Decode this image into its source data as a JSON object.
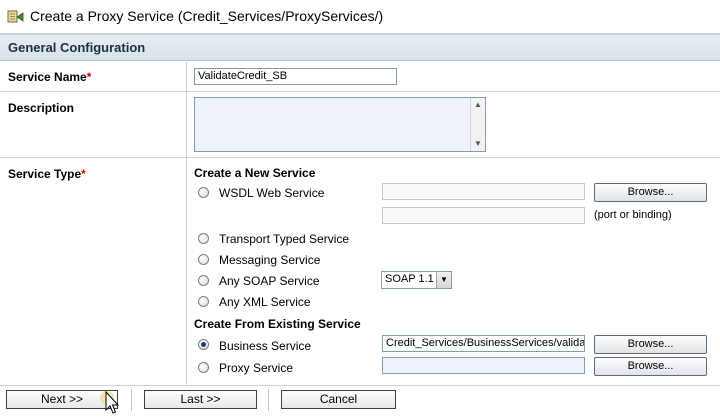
{
  "header": {
    "title": "Create a Proxy Service (Credit_Services/ProxyServices/)",
    "icon": "proxy-service-icon"
  },
  "section": {
    "title": "General Configuration"
  },
  "service_name": {
    "label": "Service Name",
    "required_mark": "*",
    "value": "ValidateCredit_SB"
  },
  "description": {
    "label": "Description",
    "value": ""
  },
  "service_type": {
    "label": "Service Type",
    "required_mark": "*",
    "create_new_title": "Create a New Service",
    "wsdl_label": "WSDL Web Service",
    "wsdl_browse": "Browse...",
    "port_hint": "(port or binding)",
    "transport_label": "Transport Typed Service",
    "messaging_label": "Messaging Service",
    "soap_label": "Any SOAP Service",
    "soap_version": "SOAP 1.1",
    "xml_label": "Any XML Service",
    "existing_title": "Create From Existing Service",
    "business_label": "Business Service",
    "business_value": "Credit_Services/BusinessServices/validatio",
    "business_browse": "Browse...",
    "proxy_label": "Proxy Service",
    "proxy_browse": "Browse...",
    "selected": "business"
  },
  "footer": {
    "next": "Next >>",
    "last": "Last >>",
    "cancel": "Cancel"
  },
  "colors": {
    "required": "#cc0000",
    "section_bg": "#dfe7ef",
    "border": "#c9d3dd"
  }
}
